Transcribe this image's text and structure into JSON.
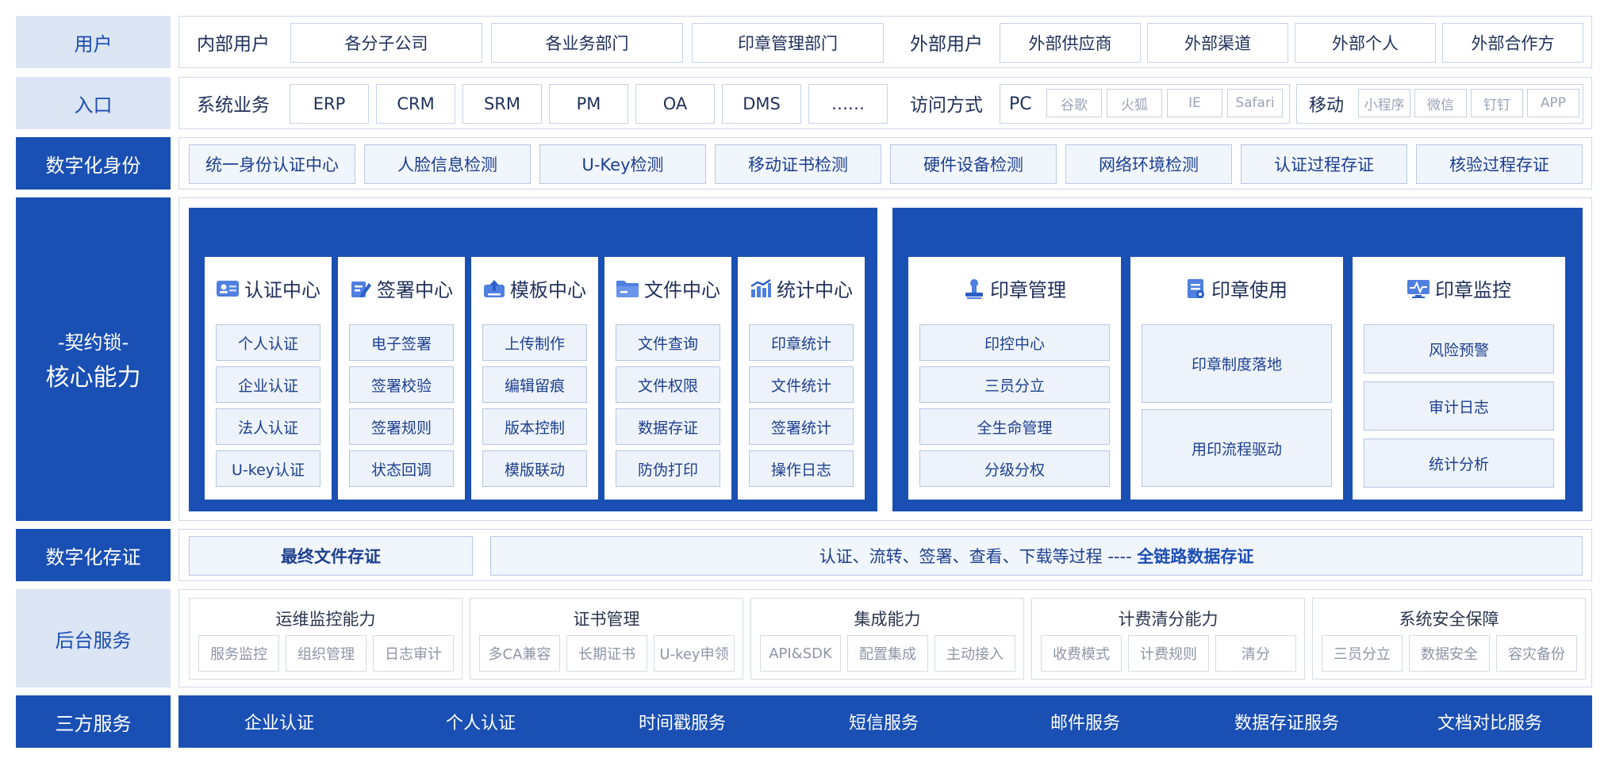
{
  "rows": {
    "users": {
      "label": "用户",
      "internal_label": "内部用户",
      "internal": [
        "各分子公司",
        "各业务部门",
        "印章管理部门"
      ],
      "external_label": "外部用户",
      "external": [
        "外部供应商",
        "外部渠道",
        "外部个人",
        "外部合作方"
      ]
    },
    "entry": {
      "label": "入口",
      "systems_label": "系统业务",
      "systems": [
        "ERP",
        "CRM",
        "SRM",
        "PM",
        "OA",
        "DMS",
        "……"
      ],
      "access_label": "访问方式",
      "pc_label": "PC",
      "pc": [
        "谷歌",
        "火狐",
        "IE",
        "Safari"
      ],
      "mobile_label": "移动",
      "mobile": [
        "小程序",
        "微信",
        "钉钉",
        "APP"
      ]
    },
    "identity": {
      "label": "数字化身份",
      "items": [
        "统一身份认证中心",
        "人脸信息检测",
        "U-Key检测",
        "移动证书检测",
        "硬件设备检测",
        "网络环境检测",
        "认证过程存证",
        "核验过程存证"
      ]
    },
    "core": {
      "label_line1": "-契约锁-",
      "label_line2": "核心能力",
      "left_cards": [
        {
          "title": "认证中心",
          "icon": "id-card-icon",
          "items": [
            "个人认证",
            "企业认证",
            "法人认证",
            "U-key认证"
          ]
        },
        {
          "title": "签署中心",
          "icon": "sign-pen-icon",
          "items": [
            "电子签署",
            "签署校验",
            "签署规则",
            "状态回调"
          ]
        },
        {
          "title": "模板中心",
          "icon": "upload-template-icon",
          "items": [
            "上传制作",
            "编辑留痕",
            "版本控制",
            "模版联动"
          ]
        },
        {
          "title": "文件中心",
          "icon": "folder-icon",
          "items": [
            "文件查询",
            "文件权限",
            "数据存证",
            "防伪打印"
          ]
        },
        {
          "title": "统计中心",
          "icon": "bar-chart-icon",
          "items": [
            "印章统计",
            "文件统计",
            "签署统计",
            "操作日志"
          ]
        }
      ],
      "right_cards": [
        {
          "title": "印章管理",
          "icon": "seal-icon",
          "items": [
            "印控中心",
            "三员分立",
            "全生命管理",
            "分级分权"
          ]
        },
        {
          "title": "印章使用",
          "icon": "document-icon",
          "items": [
            "印章制度落地",
            "用印流程驱动"
          ]
        },
        {
          "title": "印章监控",
          "icon": "monitor-icon",
          "items": [
            "风险预警",
            "审计日志",
            "统计分析"
          ]
        }
      ]
    },
    "evidence": {
      "label": "数字化存证",
      "final": "最终文件存证",
      "process_text": "认证、流转、签署、查看、下载等过程 ---- ",
      "process_bold": "全链路数据存证"
    },
    "backend": {
      "label": "后台服务",
      "groups": [
        {
          "title": "运维监控能力",
          "items": [
            "服务监控",
            "组织管理",
            "日志审计"
          ]
        },
        {
          "title": "证书管理",
          "items": [
            "多CA兼容",
            "长期证书",
            "U-key申领"
          ]
        },
        {
          "title": "集成能力",
          "items": [
            "API&SDK",
            "配置集成",
            "主动接入"
          ]
        },
        {
          "title": "计费清分能力",
          "items": [
            "收费模式",
            "计费规则",
            "清分"
          ]
        },
        {
          "title": "系统安全保障",
          "items": [
            "三员分立",
            "数据安全",
            "容灾备份"
          ]
        }
      ]
    },
    "third": {
      "label": "三方服务",
      "items": [
        "企业认证",
        "个人认证",
        "时间戳服务",
        "短信服务",
        "邮件服务",
        "数据存证服务",
        "文档对比服务"
      ]
    }
  },
  "colors": {
    "primary": "#1a4fb4",
    "light": "#dbe5f4",
    "card_item": "#eef3fb"
  }
}
